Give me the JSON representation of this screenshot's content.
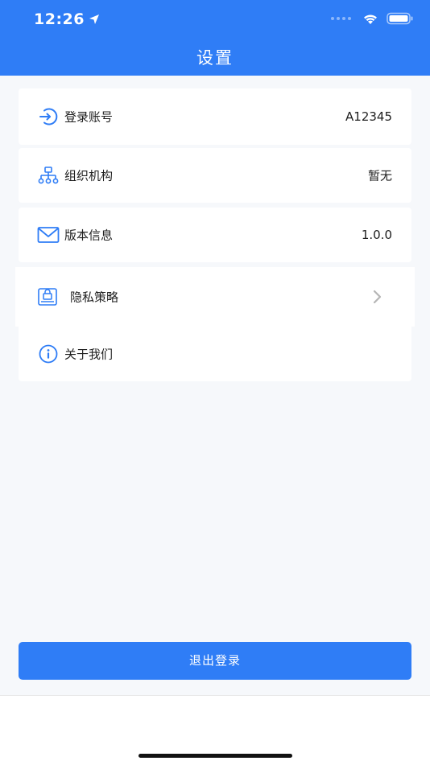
{
  "status_bar": {
    "time": "12:26"
  },
  "header": {
    "title": "设置"
  },
  "settings": {
    "account": {
      "label": "登录账号",
      "value": "A12345",
      "icon": "login-arrow-icon"
    },
    "organization": {
      "label": "组织机构",
      "value": "暂无",
      "icon": "org-tree-icon"
    },
    "version": {
      "label": "版本信息",
      "value": "1.0.0",
      "icon": "envelope-icon"
    },
    "privacy": {
      "label": "隐私策略",
      "icon": "lock-document-icon"
    },
    "about": {
      "label": "关于我们",
      "icon": "info-circle-icon"
    }
  },
  "logout": {
    "label": "退出登录"
  },
  "colors": {
    "primary": "#2f7df6",
    "background": "#f6f8fb",
    "card": "#ffffff"
  }
}
